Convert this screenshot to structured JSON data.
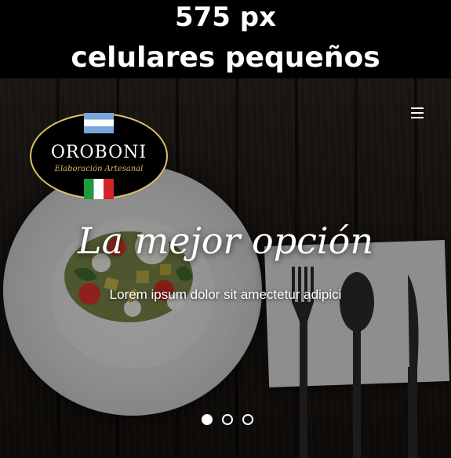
{
  "banner": {
    "width_label": "575 px",
    "device_label": "celulares pequeños"
  },
  "logo": {
    "name": "OROBONI",
    "tagline": "Elaboración Artesanal"
  },
  "menu": {
    "icon": "hamburger-menu-icon"
  },
  "hero": {
    "headline": "La mejor opción",
    "subheadline": "Lorem ipsum dolor sit amectetur adipici"
  },
  "carousel": {
    "slides": 3,
    "active_index": 0
  },
  "colors": {
    "logo_border": "#e1c16a",
    "argentina_blue": "#79a7dd",
    "italy_green": "#1f9b3b",
    "italy_red": "#d3242a"
  }
}
